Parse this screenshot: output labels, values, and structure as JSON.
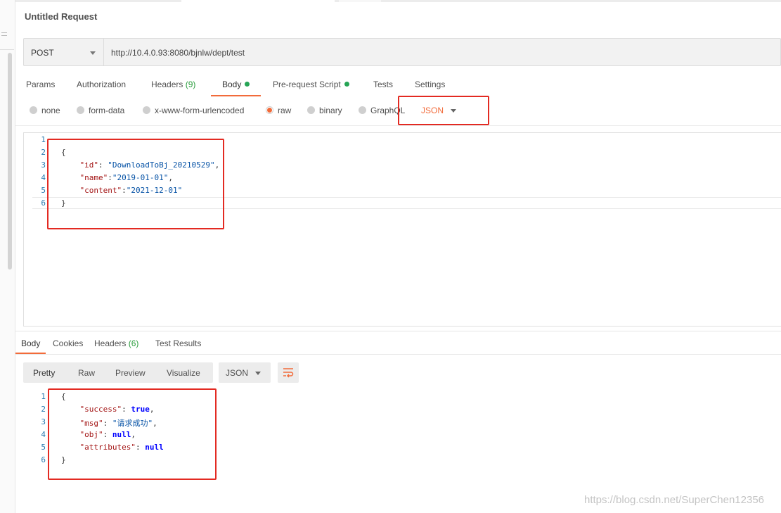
{
  "request": {
    "title": "Untitled Request",
    "method": "POST",
    "url": "http://10.4.0.93:8080/bjnlw/dept/test"
  },
  "request_tabs": [
    {
      "label": "Params"
    },
    {
      "label": "Authorization"
    },
    {
      "label": "Headers",
      "count": "(9)"
    },
    {
      "label": "Body",
      "active": true,
      "dot": true
    },
    {
      "label": "Pre-request Script",
      "dot": true
    },
    {
      "label": "Tests"
    },
    {
      "label": "Settings"
    }
  ],
  "body_types": [
    {
      "label": "none"
    },
    {
      "label": "form-data"
    },
    {
      "label": "x-www-form-urlencoded"
    },
    {
      "label": "raw",
      "selected": true
    },
    {
      "label": "binary"
    },
    {
      "label": "GraphQL"
    }
  ],
  "raw_language": "JSON",
  "request_body": {
    "line_numbers": [
      "1",
      "2",
      "3",
      "4",
      "5",
      "6"
    ],
    "open_brace": "{",
    "close_brace": "}",
    "fields": [
      {
        "key": "\"id\"",
        "sep": ": ",
        "value": "\"DownloadToBj_20210529\"",
        "tail": ","
      },
      {
        "key": "\"name\"",
        "sep": ":",
        "value": "\"2019-01-01\"",
        "tail": ","
      },
      {
        "key": "\"content\"",
        "sep": ":",
        "value": "\"2021-12-01\"",
        "tail": ""
      }
    ]
  },
  "response_tabs": [
    {
      "label": "Body",
      "active": true
    },
    {
      "label": "Cookies"
    },
    {
      "label": "Headers",
      "count": "(6)"
    },
    {
      "label": "Test Results"
    }
  ],
  "response_views": [
    "Pretty",
    "Raw",
    "Preview",
    "Visualize"
  ],
  "response_format": "JSON",
  "wrap_icon": "wrap-lines-icon",
  "response_body": {
    "line_numbers": [
      "1",
      "2",
      "3",
      "4",
      "5",
      "6"
    ],
    "open_brace": "{",
    "close_brace": "}",
    "fields": [
      {
        "key": "\"success\"",
        "sep": ": ",
        "value": "true",
        "tail": ",",
        "type": "literal"
      },
      {
        "key": "\"msg\"",
        "sep": ": ",
        "value": "\"请求成功\"",
        "tail": ",",
        "type": "string"
      },
      {
        "key": "\"obj\"",
        "sep": ": ",
        "value": "null",
        "tail": ",",
        "type": "literal"
      },
      {
        "key": "\"attributes\"",
        "sep": ": ",
        "value": "null",
        "tail": "",
        "type": "literal"
      }
    ]
  },
  "watermark": "https://blog.csdn.net/SuperChen12356",
  "colors": {
    "accent": "#f26b3a",
    "annotation_red": "#e32a22",
    "status_green": "#26a455"
  }
}
